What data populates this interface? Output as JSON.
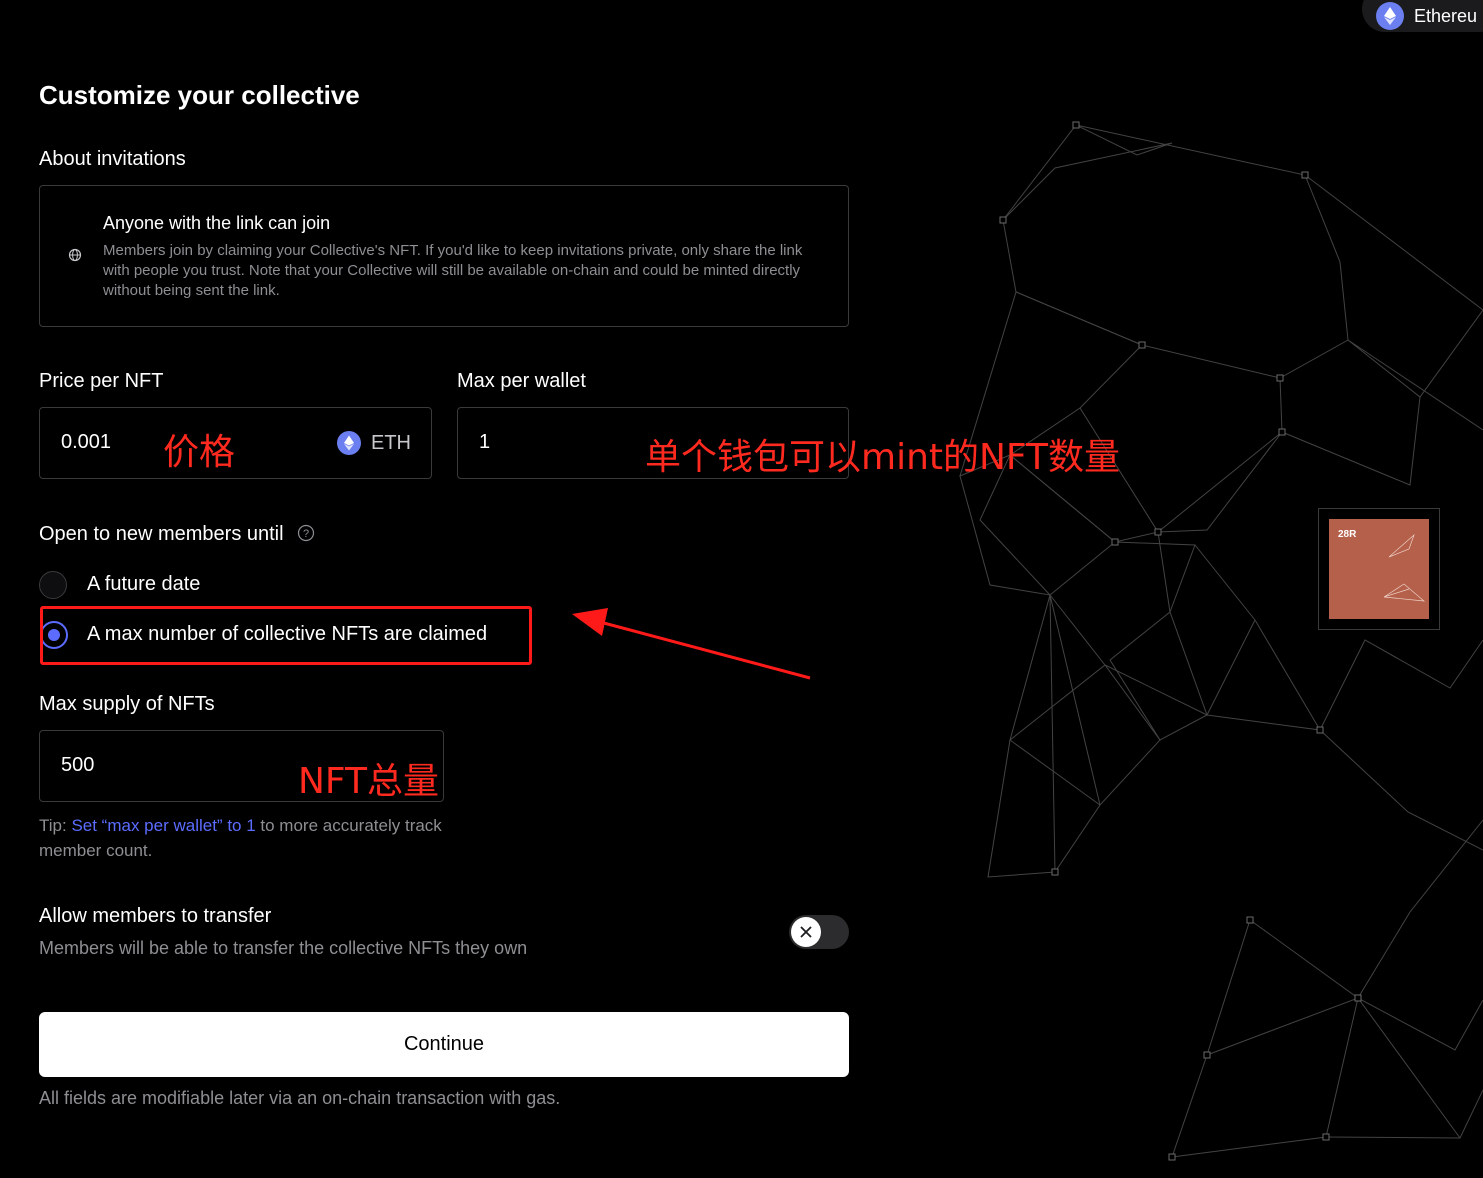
{
  "network": {
    "label": "Ethereu",
    "icon": "ethereum-icon"
  },
  "page_title": "Customize your collective",
  "invitations": {
    "section_label": "About invitations",
    "icon": "globe-icon",
    "title": "Anyone with the link can join",
    "description": "Members join by claiming your Collective's NFT. If you'd like to keep invitations private, only share the link with people you trust. Note that your Collective will still be available on-chain and could be minted directly without being sent the link."
  },
  "price": {
    "label": "Price per NFT",
    "value": "0.001",
    "currency": "ETH",
    "annotation": "价格"
  },
  "max_per_wallet": {
    "label": "Max per wallet",
    "value": "1",
    "annotation": "单个钱包可以mint的NFT数量"
  },
  "open_until": {
    "label": "Open to new members until",
    "help_icon": "question-circle-icon",
    "options": [
      {
        "label": "A future date",
        "selected": false
      },
      {
        "label": "A max number of collective NFTs are claimed",
        "selected": true
      }
    ]
  },
  "max_supply": {
    "label": "Max supply of NFTs",
    "value": "500",
    "annotation": "NFT总量",
    "tip_prefix": "Tip: ",
    "tip_link": "Set “max per wallet” to 1",
    "tip_suffix": " to more accurately track member count."
  },
  "transfer": {
    "label": "Allow members to transfer",
    "description": "Members will be able to transfer the collective NFTs they own",
    "enabled": false,
    "icon": "x-icon"
  },
  "continue_label": "Continue",
  "footnote": "All fields are modifiable later via an on-chain transaction with gas.",
  "preview": {
    "tag": "28R"
  },
  "colors": {
    "accent": "#5b6cff",
    "annotation": "#ff2a1f",
    "preview_bg": "#b4604a"
  }
}
